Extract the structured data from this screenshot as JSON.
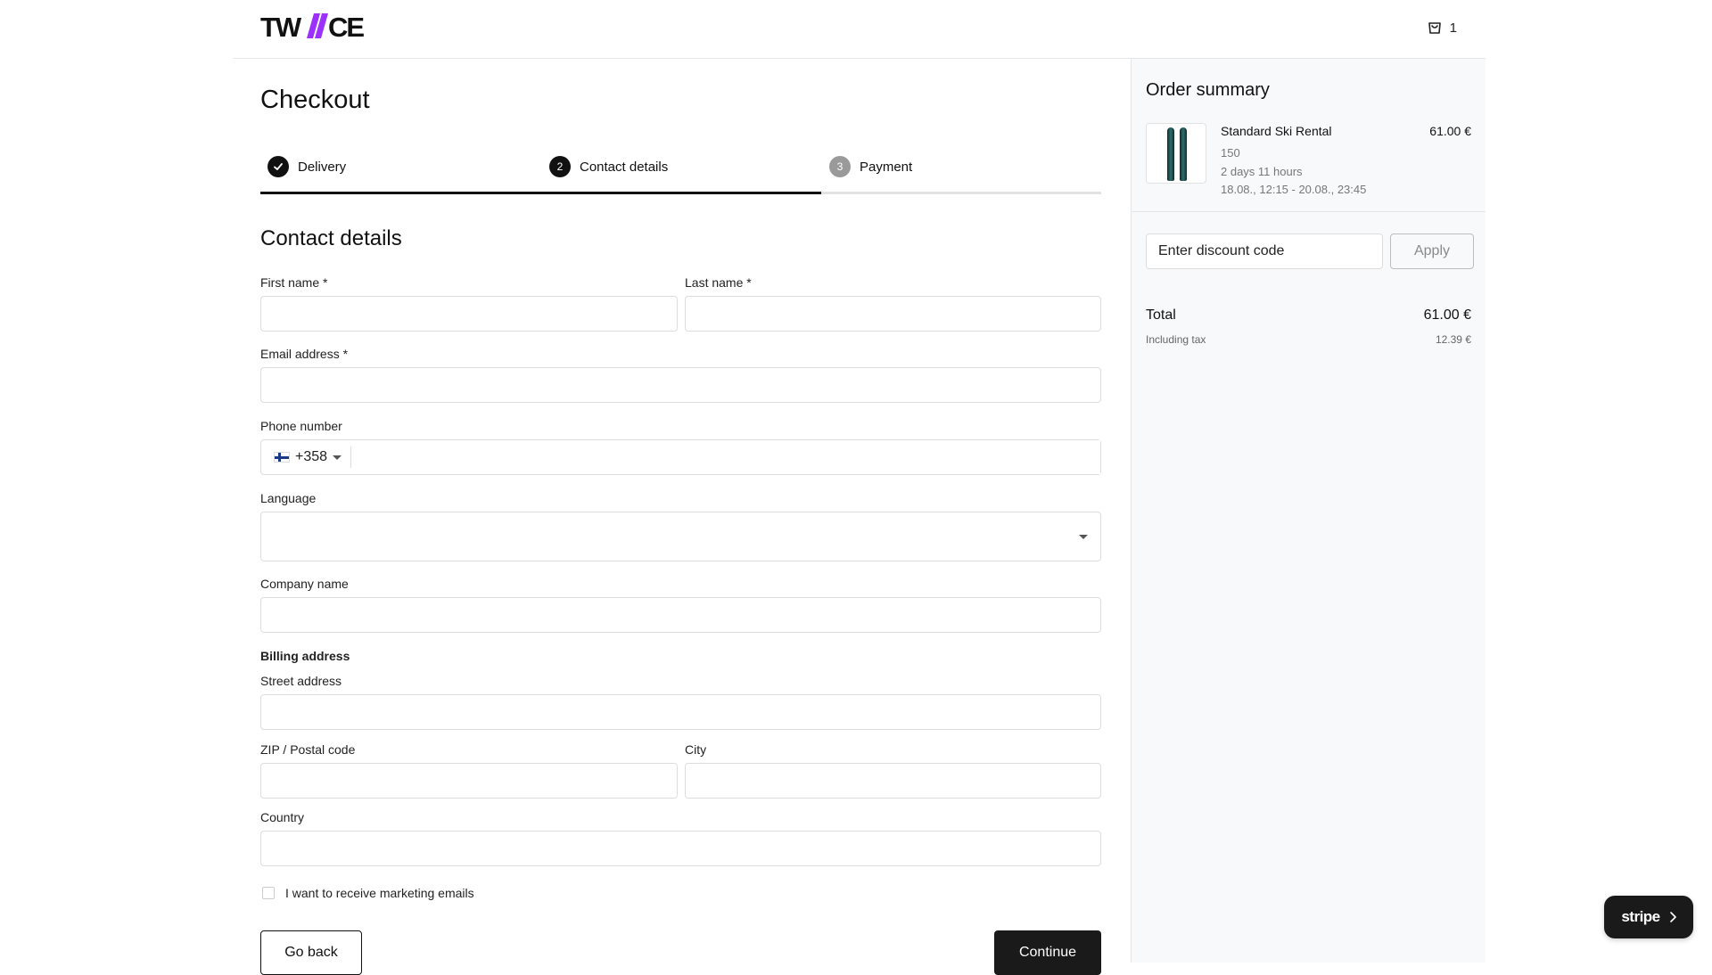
{
  "header": {
    "brand": "TWICE",
    "cart_count": "1",
    "accent_color": "#9b30ff"
  },
  "checkout": {
    "title": "Checkout",
    "steps": [
      {
        "number": "1",
        "label": "Delivery",
        "status": "completed"
      },
      {
        "number": "2",
        "label": "Contact details",
        "status": "current"
      },
      {
        "number": "3",
        "label": "Payment",
        "status": "pending"
      }
    ],
    "step_progress": 0.667
  },
  "form": {
    "section_title": "Contact details",
    "first_name_label": "First name *",
    "last_name_label": "Last name *",
    "email_label": "Email address *",
    "phone_label": "Phone number",
    "phone_country_code": "+358",
    "phone_flag": "finland-flag-icon",
    "language_label": "Language",
    "company_label": "Company name",
    "billing_heading": "Billing address",
    "street_label": "Street address",
    "zip_label": "ZIP / Postal code",
    "city_label": "City",
    "country_label": "Country",
    "marketing_label": "I want to receive marketing emails",
    "back_label": "Go back",
    "continue_label": "Continue"
  },
  "summary": {
    "title": "Order summary",
    "item": {
      "name": "Standard Ski Rental",
      "price": "61.00 €",
      "size": "150",
      "duration": "2 days 11 hours",
      "dates": "18.08., 12:15 - 20.08., 23:45"
    },
    "discount_placeholder": "Enter discount code",
    "apply_label": "Apply",
    "total_label": "Total",
    "total_value": "61.00 €",
    "tax_label": "Including tax",
    "tax_value": "12.39 €"
  },
  "stripe": {
    "label": "stripe"
  }
}
